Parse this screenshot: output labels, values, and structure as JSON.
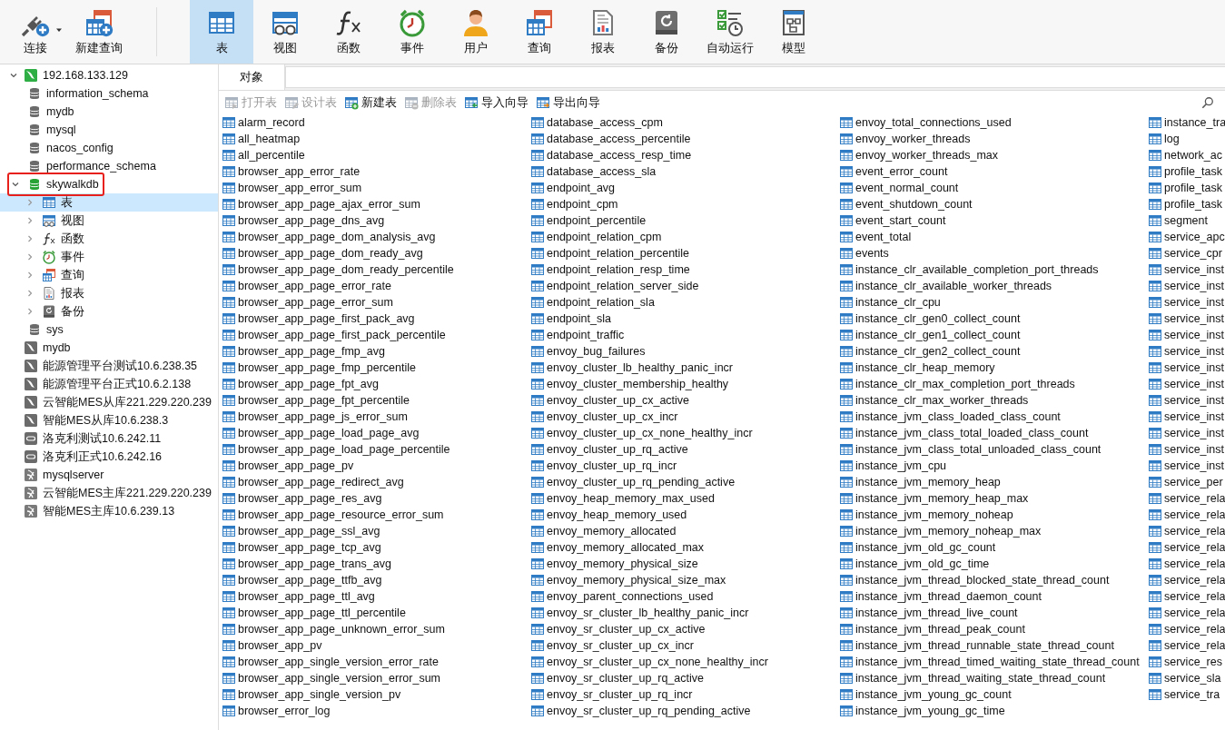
{
  "toolbar": {
    "left": [
      {
        "label": "连接",
        "kind": "connect",
        "dropdown": true
      },
      {
        "label": "新建查询",
        "kind": "newquery"
      }
    ],
    "main": [
      {
        "label": "表",
        "kind": "table",
        "selected": true
      },
      {
        "label": "视图",
        "kind": "view",
        "selected": false
      },
      {
        "label": "函数",
        "kind": "function",
        "selected": false
      },
      {
        "label": "事件",
        "kind": "event",
        "selected": false
      },
      {
        "label": "用户",
        "kind": "user",
        "selected": false
      },
      {
        "label": "查询",
        "kind": "query",
        "selected": false
      },
      {
        "label": "报表",
        "kind": "report",
        "selected": false
      },
      {
        "label": "备份",
        "kind": "backup",
        "selected": false
      },
      {
        "label": "自动运行",
        "kind": "automation",
        "selected": false
      },
      {
        "label": "模型",
        "kind": "model",
        "selected": false
      }
    ]
  },
  "sidebar": {
    "tree": [
      {
        "label": "192.168.133.129",
        "kind": "mysql",
        "open": true,
        "expanded": true,
        "children": [
          {
            "label": "information_schema",
            "kind": "database",
            "open": false
          },
          {
            "label": "mydb",
            "kind": "database",
            "open": false
          },
          {
            "label": "mysql",
            "kind": "database",
            "open": false
          },
          {
            "label": "nacos_config",
            "kind": "database",
            "open": false
          },
          {
            "label": "performance_schema",
            "kind": "database",
            "open": false
          },
          {
            "label": "skywalkdb",
            "kind": "database",
            "open": true,
            "expanded": true,
            "highlighted": true,
            "children": [
              {
                "label": "表",
                "kind": "table",
                "expanded": false,
                "selected": true
              },
              {
                "label": "视图",
                "kind": "view",
                "expanded": false,
                "selected": false
              },
              {
                "label": "函数",
                "kind": "function",
                "expanded": false,
                "selected": false
              },
              {
                "label": "事件",
                "kind": "event",
                "expanded": false,
                "selected": false
              },
              {
                "label": "查询",
                "kind": "query",
                "expanded": false,
                "selected": false
              },
              {
                "label": "报表",
                "kind": "report",
                "expanded": false,
                "selected": false
              },
              {
                "label": "备份",
                "kind": "backup",
                "expanded": false,
                "selected": false
              }
            ]
          },
          {
            "label": "sys",
            "kind": "database",
            "open": false
          }
        ]
      },
      {
        "label": "mydb",
        "kind": "mysql",
        "open": false
      },
      {
        "label": "能源管理平台测试10.6.238.35",
        "kind": "mysql",
        "open": false
      },
      {
        "label": "能源管理平台正式10.6.2.138",
        "kind": "mysql",
        "open": false
      },
      {
        "label": "云智能MES从库221.229.220.239",
        "kind": "mysql",
        "open": false
      },
      {
        "label": "智能MES从库10.6.238.3",
        "kind": "mysql",
        "open": false
      },
      {
        "label": "洛克利测试10.6.242.11",
        "kind": "oracle",
        "open": false
      },
      {
        "label": "洛克利正式10.6.242.16",
        "kind": "oracle",
        "open": false
      },
      {
        "label": "mysqlserver",
        "kind": "sqlserver",
        "open": false
      },
      {
        "label": "云智能MES主库221.229.220.239",
        "kind": "sqlserver",
        "open": false
      },
      {
        "label": "智能MES主库10.6.239.13",
        "kind": "sqlserver",
        "open": false
      }
    ]
  },
  "objects": {
    "tabs": [
      {
        "label": "对象",
        "selected": true
      }
    ],
    "actions": [
      {
        "label": "打开表",
        "kind": "open",
        "disabled": true
      },
      {
        "label": "设计表",
        "kind": "design",
        "disabled": true
      },
      {
        "label": "新建表",
        "kind": "new",
        "disabled": false
      },
      {
        "label": "删除表",
        "kind": "delete",
        "disabled": true
      },
      {
        "label": "导入向导",
        "kind": "import",
        "disabled": false
      },
      {
        "label": "导出向导",
        "kind": "export",
        "disabled": false
      }
    ],
    "tables": [
      "alarm_record",
      "all_heatmap",
      "all_percentile",
      "browser_app_error_rate",
      "browser_app_error_sum",
      "browser_app_page_ajax_error_sum",
      "browser_app_page_dns_avg",
      "browser_app_page_dom_analysis_avg",
      "browser_app_page_dom_ready_avg",
      "browser_app_page_dom_ready_percentile",
      "browser_app_page_error_rate",
      "browser_app_page_error_sum",
      "browser_app_page_first_pack_avg",
      "browser_app_page_first_pack_percentile",
      "browser_app_page_fmp_avg",
      "browser_app_page_fmp_percentile",
      "browser_app_page_fpt_avg",
      "browser_app_page_fpt_percentile",
      "browser_app_page_js_error_sum",
      "browser_app_page_load_page_avg",
      "browser_app_page_load_page_percentile",
      "browser_app_page_pv",
      "browser_app_page_redirect_avg",
      "browser_app_page_res_avg",
      "browser_app_page_resource_error_sum",
      "browser_app_page_ssl_avg",
      "browser_app_page_tcp_avg",
      "browser_app_page_trans_avg",
      "browser_app_page_ttfb_avg",
      "browser_app_page_ttl_avg",
      "browser_app_page_ttl_percentile",
      "browser_app_page_unknown_error_sum",
      "browser_app_pv",
      "browser_app_single_version_error_rate",
      "browser_app_single_version_error_sum",
      "browser_app_single_version_pv",
      "browser_error_log",
      "database_access_cpm",
      "database_access_percentile",
      "database_access_resp_time",
      "database_access_sla",
      "endpoint_avg",
      "endpoint_cpm",
      "endpoint_percentile",
      "endpoint_relation_cpm",
      "endpoint_relation_percentile",
      "endpoint_relation_resp_time",
      "endpoint_relation_server_side",
      "endpoint_relation_sla",
      "endpoint_sla",
      "endpoint_traffic",
      "envoy_bug_failures",
      "envoy_cluster_lb_healthy_panic_incr",
      "envoy_cluster_membership_healthy",
      "envoy_cluster_up_cx_active",
      "envoy_cluster_up_cx_incr",
      "envoy_cluster_up_cx_none_healthy_incr",
      "envoy_cluster_up_rq_active",
      "envoy_cluster_up_rq_incr",
      "envoy_cluster_up_rq_pending_active",
      "envoy_heap_memory_max_used",
      "envoy_heap_memory_used",
      "envoy_memory_allocated",
      "envoy_memory_allocated_max",
      "envoy_memory_physical_size",
      "envoy_memory_physical_size_max",
      "envoy_parent_connections_used",
      "envoy_sr_cluster_lb_healthy_panic_incr",
      "envoy_sr_cluster_up_cx_active",
      "envoy_sr_cluster_up_cx_incr",
      "envoy_sr_cluster_up_cx_none_healthy_incr",
      "envoy_sr_cluster_up_rq_active",
      "envoy_sr_cluster_up_rq_incr",
      "envoy_sr_cluster_up_rq_pending_active",
      "envoy_total_connections_used",
      "envoy_worker_threads",
      "envoy_worker_threads_max",
      "event_error_count",
      "event_normal_count",
      "event_shutdown_count",
      "event_start_count",
      "event_total",
      "events",
      "instance_clr_available_completion_port_threads",
      "instance_clr_available_worker_threads",
      "instance_clr_cpu",
      "instance_clr_gen0_collect_count",
      "instance_clr_gen1_collect_count",
      "instance_clr_gen2_collect_count",
      "instance_clr_heap_memory",
      "instance_clr_max_completion_port_threads",
      "instance_clr_max_worker_threads",
      "instance_jvm_class_loaded_class_count",
      "instance_jvm_class_total_loaded_class_count",
      "instance_jvm_class_total_unloaded_class_count",
      "instance_jvm_cpu",
      "instance_jvm_memory_heap",
      "instance_jvm_memory_heap_max",
      "instance_jvm_memory_noheap",
      "instance_jvm_memory_noheap_max",
      "instance_jvm_old_gc_count",
      "instance_jvm_old_gc_time",
      "instance_jvm_thread_blocked_state_thread_count",
      "instance_jvm_thread_daemon_count",
      "instance_jvm_thread_live_count",
      "instance_jvm_thread_peak_count",
      "instance_jvm_thread_runnable_state_thread_count",
      "instance_jvm_thread_timed_waiting_state_thread_count",
      "instance_jvm_thread_waiting_state_thread_count",
      "instance_jvm_young_gc_count",
      "instance_jvm_young_gc_time",
      "instance_tra",
      "log",
      "network_ac",
      "profile_task",
      "profile_task",
      "profile_task",
      "segment",
      "service_apc",
      "service_cpr",
      "service_inst",
      "service_inst",
      "service_inst",
      "service_inst",
      "service_inst",
      "service_inst",
      "service_inst",
      "service_inst",
      "service_inst",
      "service_inst",
      "service_inst",
      "service_inst",
      "service_inst",
      "service_per",
      "service_rela",
      "service_rela",
      "service_rela",
      "service_rela",
      "service_rela",
      "service_rela",
      "service_rela",
      "service_rela",
      "service_rela",
      "service_rela",
      "service_res",
      "service_sla",
      "service_tra"
    ]
  }
}
